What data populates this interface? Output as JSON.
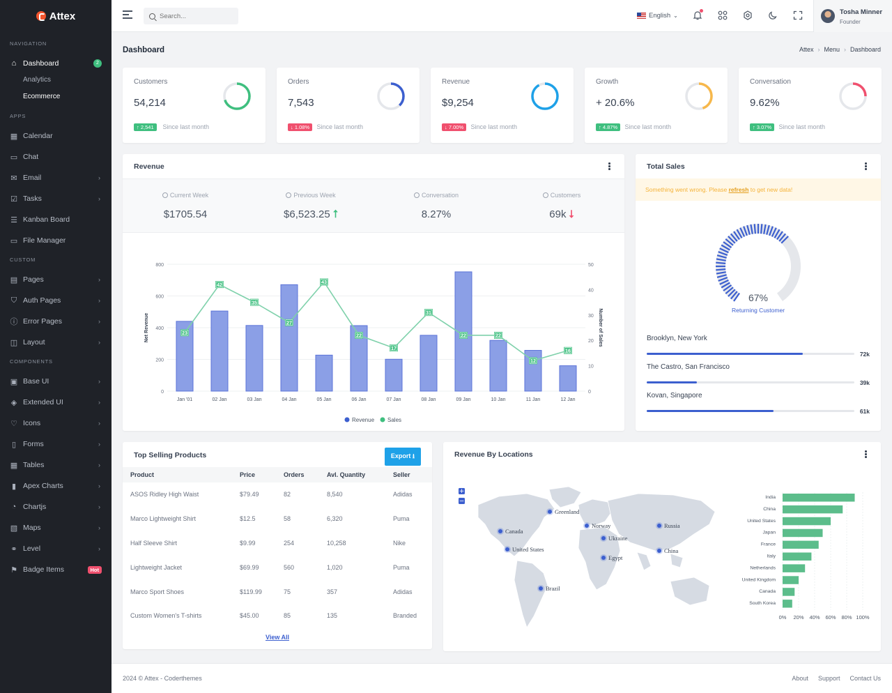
{
  "brand": {
    "name": "Attex"
  },
  "sidebar": {
    "sections": [
      {
        "heading": "Navigation",
        "items": [
          {
            "label": "Dashboard",
            "icon": "home-icon",
            "badge": "2",
            "active": true,
            "children": [
              {
                "label": "Analytics"
              },
              {
                "label": "Ecommerce",
                "current": true
              }
            ]
          }
        ]
      },
      {
        "heading": "Apps",
        "items": [
          {
            "label": "Calendar",
            "icon": "calendar-icon"
          },
          {
            "label": "Chat",
            "icon": "chat-icon"
          },
          {
            "label": "Email",
            "icon": "mail-icon",
            "chevron": true
          },
          {
            "label": "Tasks",
            "icon": "task-icon",
            "chevron": true
          },
          {
            "label": "Kanban Board",
            "icon": "kanban-icon"
          },
          {
            "label": "File Manager",
            "icon": "folder-icon"
          }
        ]
      },
      {
        "heading": "Custom",
        "items": [
          {
            "label": "Pages",
            "icon": "page-icon",
            "chevron": true
          },
          {
            "label": "Auth Pages",
            "icon": "shield-icon",
            "chevron": true
          },
          {
            "label": "Error Pages",
            "icon": "error-icon",
            "chevron": true
          },
          {
            "label": "Layout",
            "icon": "layout-icon",
            "chevron": true
          }
        ]
      },
      {
        "heading": "Components",
        "items": [
          {
            "label": "Base UI",
            "icon": "briefcase-icon",
            "chevron": true
          },
          {
            "label": "Extended UI",
            "icon": "stack-icon",
            "chevron": true
          },
          {
            "label": "Icons",
            "icon": "heart-icon",
            "chevron": true
          },
          {
            "label": "Forms",
            "icon": "clipboard-icon",
            "chevron": true
          },
          {
            "label": "Tables",
            "icon": "table-icon",
            "chevron": true
          },
          {
            "label": "Apex Charts",
            "icon": "bar-chart-icon",
            "chevron": true
          },
          {
            "label": "Chartjs",
            "icon": "pie-chart-icon",
            "chevron": true
          },
          {
            "label": "Maps",
            "icon": "map-icon",
            "chevron": true
          },
          {
            "label": "Level",
            "icon": "share-icon",
            "chevron": true
          },
          {
            "label": "Badge Items",
            "icon": "flag-icon",
            "badge_hot": "Hot"
          }
        ]
      }
    ]
  },
  "topbar": {
    "search_placeholder": "Search...",
    "language": "English",
    "user_name": "Tosha Minner",
    "user_role": "Founder"
  },
  "page": {
    "title": "Dashboard",
    "breadcrumb": [
      "Attex",
      "Menu",
      "Dashboard"
    ]
  },
  "stats": [
    {
      "label": "Customers",
      "value": "54,214",
      "change": "2,541",
      "trend": "up",
      "since": "Since last month",
      "ring_color": "#3fbf7f",
      "ring_fraction": 0.7
    },
    {
      "label": "Orders",
      "value": "7,543",
      "change": "1.08%",
      "trend": "down",
      "since": "Since last month",
      "ring_color": "#3c5fcf",
      "ring_fraction": 0.38
    },
    {
      "label": "Revenue",
      "value": "$9,254",
      "change": "7.00%",
      "trend": "down",
      "since": "Since last month",
      "ring_color": "#1ea1e8",
      "ring_fraction": 0.92
    },
    {
      "label": "Growth",
      "value": "+ 20.6%",
      "change": "4.87%",
      "trend": "up",
      "since": "Since last month",
      "ring_color": "#f7b84b",
      "ring_fraction": 0.45
    },
    {
      "label": "Conversation",
      "value": "9.62%",
      "change": "3.07%",
      "trend": "up",
      "since": "Since last month",
      "ring_color": "#f0506e",
      "ring_fraction": 0.25
    }
  ],
  "revenue": {
    "title": "Revenue",
    "summary": [
      {
        "label": "Current Week",
        "value": "$1705.54",
        "arrow": ""
      },
      {
        "label": "Previous Week",
        "value": "$6,523.25",
        "arrow": "up"
      },
      {
        "label": "Conversation",
        "value": "8.27%",
        "arrow": ""
      },
      {
        "label": "Customers",
        "value": "69k",
        "arrow": "down"
      }
    ]
  },
  "chart_data": {
    "type": "bar",
    "categories": [
      "Jan '01",
      "02 Jan",
      "03 Jan",
      "04 Jan",
      "05 Jan",
      "06 Jan",
      "07 Jan",
      "08 Jan",
      "09 Jan",
      "10 Jan",
      "11 Jan",
      "12 Jan"
    ],
    "series": [
      {
        "name": "Revenue",
        "type": "bar",
        "axis": "left",
        "color": "#8b9fe6",
        "values": [
          440,
          505,
          414,
          671,
          227,
          413,
          201,
          352,
          752,
          320,
          257,
          160
        ]
      },
      {
        "name": "Sales",
        "type": "line",
        "axis": "right",
        "color": "#7fd1ab",
        "values": [
          23,
          42,
          35,
          27,
          43,
          22,
          17,
          31,
          22,
          22,
          12,
          16
        ]
      }
    ],
    "ylabel": "Net Revenue",
    "ylabel_right": "Number of Sales",
    "ylim": [
      0,
      800
    ],
    "yticks": [
      0,
      200,
      400,
      600,
      800
    ],
    "ylim_right": [
      0,
      50
    ],
    "yticks_right": [
      0,
      10,
      20,
      30,
      40,
      50
    ],
    "grid": true,
    "legend": "bottom"
  },
  "total_sales": {
    "title": "Total Sales",
    "alert_prefix": "Something went wrong. Please",
    "alert_link": "refresh",
    "alert_suffix": "to get new data!",
    "gauge_value": "67%",
    "gauge_fraction": 0.67,
    "gauge_label": "Returning Customer",
    "locations": [
      {
        "name": "Brooklyn, New York",
        "value": "72k",
        "fraction": 0.75
      },
      {
        "name": "The Castro, San Francisco",
        "value": "39k",
        "fraction": 0.24
      },
      {
        "name": "Kovan, Singapore",
        "value": "61k",
        "fraction": 0.61
      }
    ]
  },
  "products": {
    "title": "Top Selling Products",
    "export_label": "Export",
    "columns": [
      "Product",
      "Price",
      "Orders",
      "Avl. Quantity",
      "Seller"
    ],
    "rows": [
      [
        "ASOS Ridley High Waist",
        "$79.49",
        "82",
        "8,540",
        "Adidas"
      ],
      [
        "Marco Lightweight Shirt",
        "$12.5",
        "58",
        "6,320",
        "Puma"
      ],
      [
        "Half Sleeve Shirt",
        "$9.99",
        "254",
        "10,258",
        "Nike"
      ],
      [
        "Lightweight Jacket",
        "$69.99",
        "560",
        "1,020",
        "Puma"
      ],
      [
        "Marco Sport Shoes",
        "$119.99",
        "75",
        "357",
        "Adidas"
      ],
      [
        "Custom Women's T-shirts",
        "$45.00",
        "85",
        "135",
        "Branded"
      ]
    ],
    "view_all": "View All"
  },
  "locations_map": {
    "title": "Revenue By Locations",
    "markers": [
      "Greenland",
      "Canada",
      "United States",
      "Norway",
      "Ukraine",
      "Egypt",
      "Russia",
      "China",
      "Brazil"
    ],
    "zoom_in": "+",
    "zoom_out": "−",
    "bar_chart": {
      "type": "bar",
      "orientation": "horizontal",
      "categories": [
        "India",
        "China",
        "United States",
        "Japan",
        "France",
        "Italy",
        "Netherlands",
        "United Kingdom",
        "Canada",
        "South Korea"
      ],
      "values": [
        0.9,
        0.75,
        0.6,
        0.5,
        0.45,
        0.36,
        0.28,
        0.2,
        0.15,
        0.12
      ],
      "xticks": [
        "0%",
        "20%",
        "40%",
        "60%",
        "80%",
        "100%"
      ],
      "color": "#5cbd8b"
    }
  },
  "footer": {
    "copyright": "2024 © Attex - Coderthemes",
    "links": [
      "About",
      "Support",
      "Contact Us"
    ]
  }
}
